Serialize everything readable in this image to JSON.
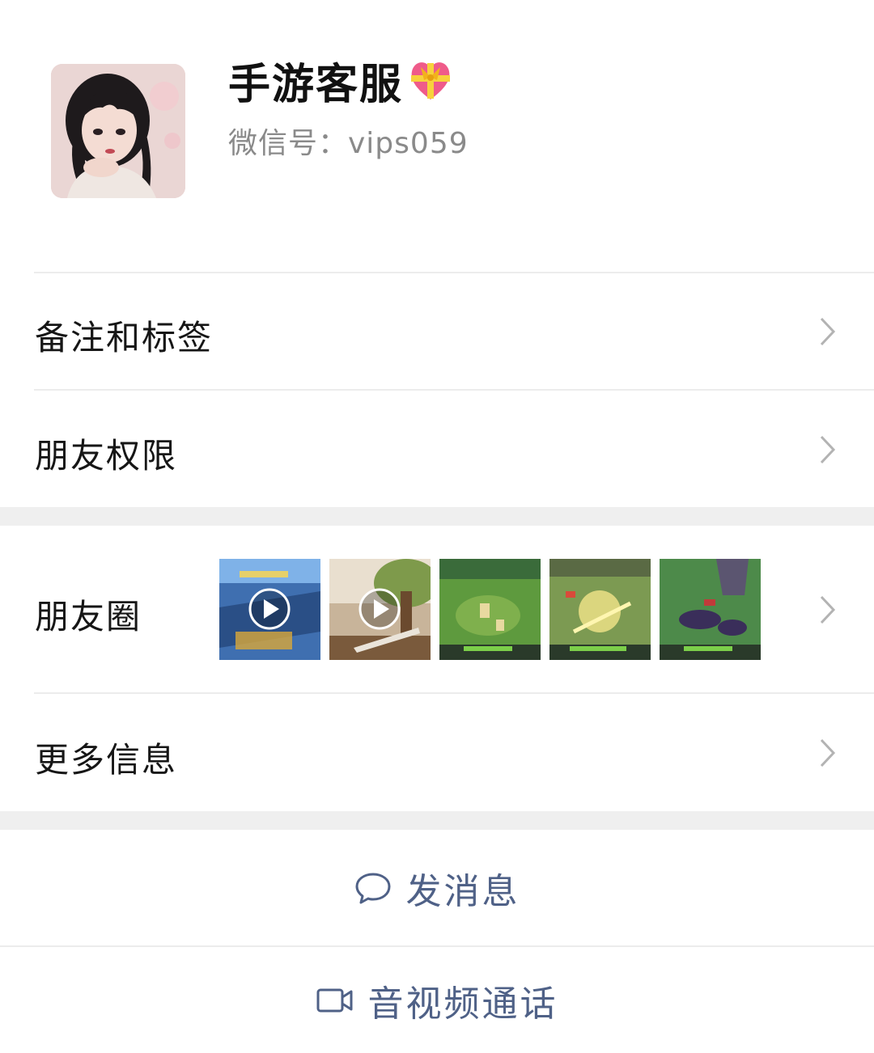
{
  "profile": {
    "name": "手游客服",
    "name_emoji": "heart-with-ribbon",
    "wechat_id": "微信号：vips059"
  },
  "menu": {
    "remarks_label": "备注和标签",
    "permissions_label": "朋友权限",
    "moments_label": "朋友圈",
    "more_info_label": "更多信息"
  },
  "moments": {
    "thumbnails": [
      {
        "kind": "video",
        "scene": "blue game ui"
      },
      {
        "kind": "video",
        "scene": "tree and character"
      },
      {
        "kind": "image",
        "scene": "green battlefield"
      },
      {
        "kind": "image",
        "scene": "battle effects"
      },
      {
        "kind": "image",
        "scene": "dark creatures"
      }
    ]
  },
  "actions": {
    "message_label": "发消息",
    "call_label": "音视频通话"
  },
  "colors": {
    "action_text": "#4f6187",
    "section_gap": "#efefef",
    "secondary_text": "#8a8a8a"
  }
}
